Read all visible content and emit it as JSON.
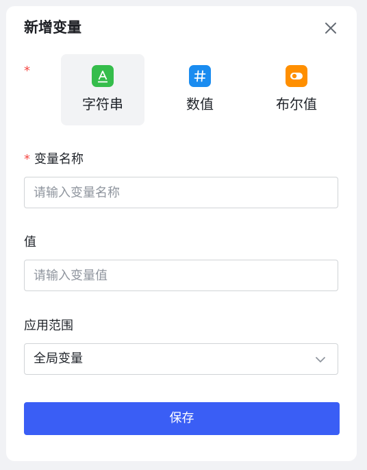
{
  "dialog": {
    "title": "新增变量",
    "required_mark": "*"
  },
  "types": [
    {
      "label": "字符串",
      "icon": "text-type-icon",
      "color": "#35bd4b",
      "selected": true
    },
    {
      "label": "数值",
      "icon": "hash-icon",
      "color": "#1a8cf0",
      "selected": false
    },
    {
      "label": "布尔值",
      "icon": "toggle-icon",
      "color": "#ff8f00",
      "selected": false
    }
  ],
  "fields": {
    "name": {
      "label": "变量名称",
      "required": true,
      "value": "",
      "placeholder": "请输入变量名称"
    },
    "value": {
      "label": "值",
      "value": "",
      "placeholder": "请输入变量值"
    },
    "scope": {
      "label": "应用范围",
      "selected": "全局变量"
    }
  },
  "actions": {
    "save_label": "保存"
  },
  "colors": {
    "primary": "#3a5ef5",
    "required": "#f54a45",
    "selected_bg": "#f2f3f5"
  }
}
